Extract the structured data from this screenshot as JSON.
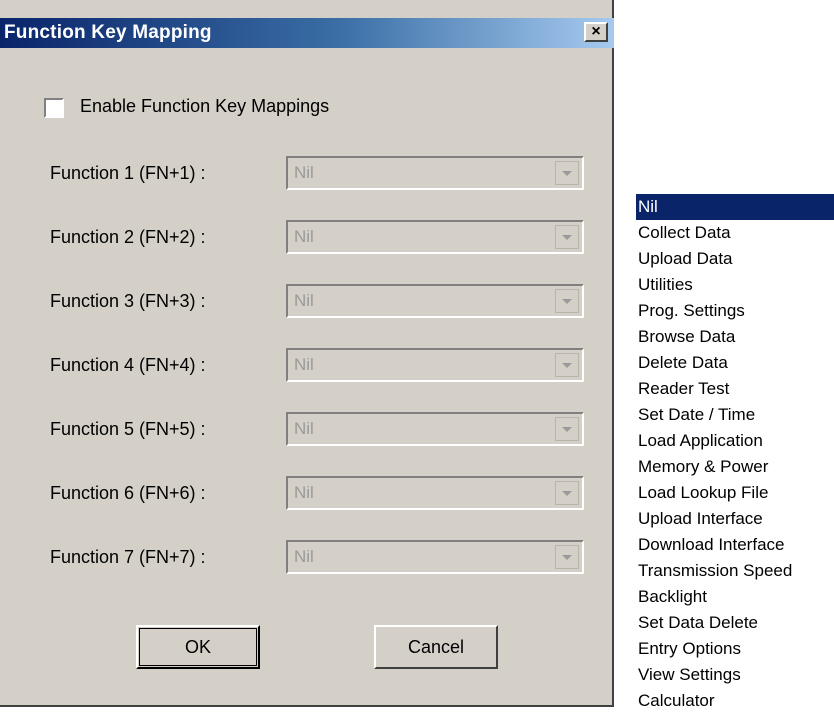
{
  "window": {
    "title": "Function Key Mapping",
    "close_label": "×"
  },
  "enable": {
    "label": "Enable Function Key Mappings",
    "checked": false
  },
  "functions": [
    {
      "label": "Function 1 (FN+1)  :",
      "value": "Nil"
    },
    {
      "label": "Function 2 (FN+2)  :",
      "value": "Nil"
    },
    {
      "label": "Function 3 (FN+3)  :",
      "value": "Nil"
    },
    {
      "label": "Function 4 (FN+4)  :",
      "value": "Nil"
    },
    {
      "label": "Function 5 (FN+5)  :",
      "value": "Nil"
    },
    {
      "label": "Function 6 (FN+6)  :",
      "value": "Nil"
    },
    {
      "label": "Function 7 (FN+7)  :",
      "value": "Nil"
    }
  ],
  "buttons": {
    "ok": "OK",
    "cancel": "Cancel"
  },
  "dropdown_options": [
    "Nil",
    "Collect Data",
    "Upload Data",
    "Utilities",
    "Prog. Settings",
    "Browse Data",
    "Delete Data",
    "Reader Test",
    "Set Date / Time",
    "Load Application",
    "Memory & Power",
    "Load Lookup File",
    "Upload Interface",
    "Download Interface",
    "Transmission Speed",
    "Backlight",
    "Set Data Delete",
    "Entry Options",
    "View Settings",
    "Calculator"
  ],
  "dropdown_selected": "Nil",
  "colors": {
    "title_bar": "#0a246a",
    "dialog_face": "#d4d0c8",
    "selection": "#0a246a",
    "disabled_text": "#9a9a9a"
  }
}
